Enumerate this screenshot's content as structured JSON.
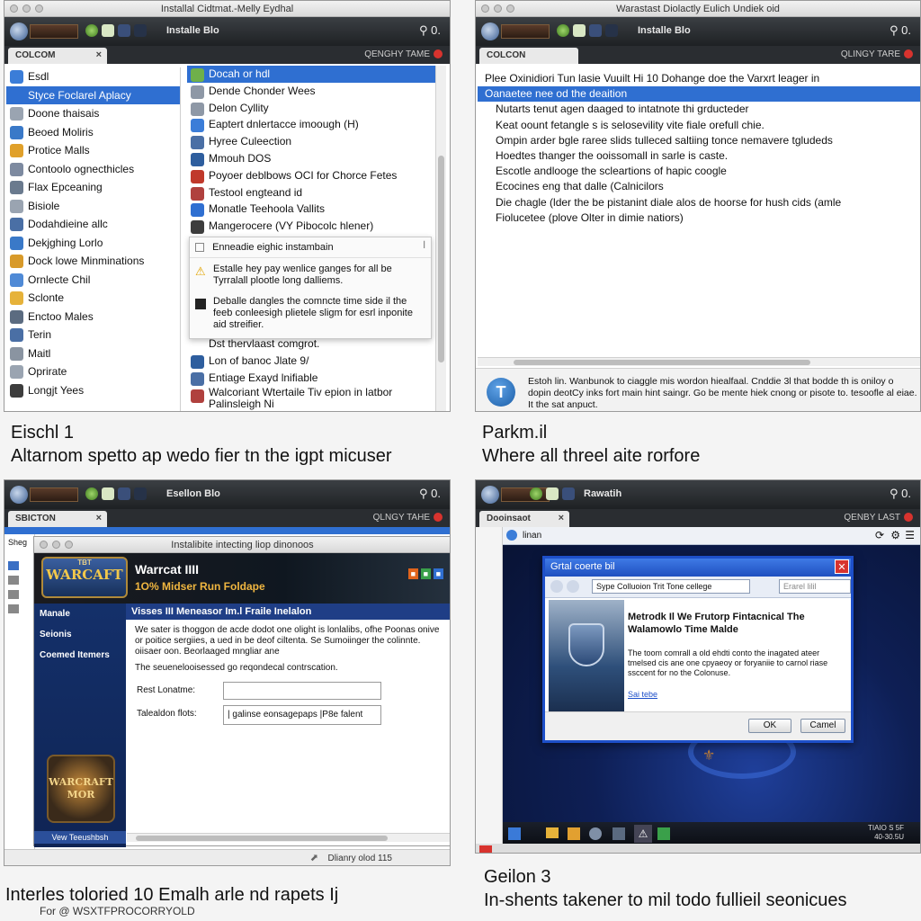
{
  "colors": {
    "selection": "#2f6fd1",
    "toolbar": "#1e2124",
    "accent_red": "#d8332e",
    "wow_blue": "#1e3a8a"
  },
  "panel1": {
    "window_title": "Installal Cidtmat.-Melly Eydhal",
    "toolbar_title": "Installe Blo",
    "toolbar_right": "⚲ 0.",
    "tab_label": "COLCOM",
    "tab_close": "×",
    "tabrow_right": "QENGHY TAME",
    "sidebar_items": [
      {
        "label": "Esdl",
        "icon": "globe-icon",
        "color": "#3b7dd8"
      },
      {
        "label": "Styce Foclarel Aplacy",
        "icon": "app-icon",
        "color": "#2f6fd1",
        "selected": true
      },
      {
        "label": "Doone thaisais",
        "icon": "document-icon",
        "color": "#9aa4b1"
      },
      {
        "label": "Beoed Moliris",
        "icon": "disk-icon",
        "color": "#3a79c8"
      },
      {
        "label": "Protice Malls",
        "icon": "folder-icon",
        "color": "#e0a02a"
      },
      {
        "label": "Contoolo ognecthicles",
        "icon": "gear-icon",
        "color": "#7d8aa0"
      },
      {
        "label": "Flax Epceaning",
        "icon": "list-icon",
        "color": "#6a7a8e"
      },
      {
        "label": "Bisiole",
        "icon": "file-icon",
        "color": "#9aa4b1"
      },
      {
        "label": "Dodahdieine allc",
        "icon": "image-icon",
        "color": "#4a6fa5"
      },
      {
        "label": "Dekjghing Lorlo",
        "icon": "monitor-icon",
        "color": "#3a79c8"
      },
      {
        "label": "Dock lowe Minminations",
        "icon": "folder-icon",
        "color": "#d89a2a"
      },
      {
        "label": "Ornlecte Chil",
        "icon": "disk-icon",
        "color": "#4f8ad6"
      },
      {
        "label": "Sclonte",
        "icon": "folder-icon",
        "color": "#e6b23a"
      },
      {
        "label": "Enctoo Males",
        "icon": "mail-icon",
        "color": "#5b6b80"
      },
      {
        "label": "Terin",
        "icon": "network-icon",
        "color": "#4a6fa5"
      },
      {
        "label": "Maitl",
        "icon": "document-icon",
        "color": "#8a94a1"
      },
      {
        "label": "Oprirate",
        "icon": "lightbulb-icon",
        "color": "#9aa4b1"
      },
      {
        "label": "Longjt Yees",
        "icon": "terminal-icon",
        "color": "#3d3d3d"
      }
    ],
    "content_items": [
      {
        "label": "Docah or hdl",
        "icon": "app-icon",
        "color": "#6fb04a",
        "selected": true
      },
      {
        "label": "Dende Chonder Wees",
        "icon": "document-icon",
        "color": "#8e98a6"
      },
      {
        "label": "Delon Cyllity",
        "icon": "document-icon",
        "color": "#8e98a6"
      },
      {
        "label": "Eaptert dnlertacce imoough (H)",
        "icon": "globe-icon",
        "color": "#3b7dd8"
      },
      {
        "label": "Hyree Culeection",
        "icon": "monitor-icon",
        "color": "#4a6fa5"
      },
      {
        "label": "Mmouh DOS",
        "icon": "disk-icon",
        "color": "#2e5e9e"
      },
      {
        "label": "Poyoer deblbows OCI for Chorce Fetes",
        "icon": "box-icon",
        "color": "#c0392b"
      },
      {
        "label": "Testool engteand id",
        "icon": "book-icon",
        "color": "#b0413e"
      },
      {
        "label": "Monatle Teehoola Vallits",
        "icon": "globe-icon",
        "color": "#2f6fd1"
      },
      {
        "label": "Mangerocere (VY Pibocolc hlener)",
        "icon": "monitor-icon",
        "color": "#3d3d3d"
      }
    ],
    "content_items_after": [
      {
        "label": "Dst thervlaast comgrot.",
        "icon": "none",
        "color": "#ffffff"
      },
      {
        "label": "Lon of banoc Jlate 9/",
        "icon": "globe-icon",
        "color": "#2e5e9e"
      },
      {
        "label": "Entiage Exayd lnifiable",
        "icon": "gear-icon",
        "color": "#4a6fa5"
      },
      {
        "label": "Walcoriant Wtertaile Tiv epion in latbor Palinsleigh Ni",
        "icon": "globe-icon",
        "color": "#b0413e"
      }
    ],
    "tooltip": {
      "header": "Enneadie eighic instambain",
      "warning": "Estalle hey pay wenlice ganges for all be Tyrralall plootle long dalliems.",
      "info": "Deballe dangles the comncte time side il the feeb conleesigh plietele sligm for esrl inponite aid streifier."
    },
    "caption_title": "Eischl 1",
    "caption_sub": "Altarnom spetto ap wedo fier tn the igpt micuser"
  },
  "panel2": {
    "window_title": "Warastast Diolactly Eulich Undiek oid",
    "toolbar_title": "Installe Blo",
    "toolbar_right": "⚲ 0.",
    "tab_label": "COLCON",
    "tabrow_right": "QLINGY TARE",
    "lines": [
      "Plee Oxinidiori Tun lasie Vuuilt Hi 10 Dohange doe the Varxrt leager in",
      "Oanaetee nee od the deaition",
      "Nutarts tenut agen daaged to intatnote thi grducteder",
      "Keat oount fetangle s is selosevility vite fiale orefull chie.",
      "Ompin arder bgle raree slids tulleced saltiing tonce nemavere tgludeds",
      "Hoedtes thanger the ooissomall in sarle is caste.",
      "Escotle andlooge the scleartions of hapic coogle",
      "Ecocines eng that dalle (Calnicilors",
      "Die chagle (lder the be pistanint diale alos de hoorse for hush cids (amle",
      "Fiolucetee (plove Olter in dimie natiors)"
    ],
    "footer_text": "Estoh lin. Wanbunok to ciaggle mis wordon hiealfaal. Cnddie 3l that bodde th is oniloy o dopin deotCy inks fort main hint saingr. Go be mente hiek cnong or pisote to. tesoofle al eiae. It the sat anpuct.",
    "footer_icon": "T",
    "caption_title": "Parkm.il",
    "caption_sub": "Where all threel aite rorfore"
  },
  "panel3": {
    "toolbar_title": "Esellon Blo",
    "toolbar_right": "⚲ 0.",
    "tab_label": "SBICTON",
    "tabrow_right": "QLNGY TAHE",
    "inner_title": "Instalibite intecting liop dinonoos",
    "logo_text": "WARCAFT",
    "logo_top": "TBT",
    "app_name": "Warrcat IIII",
    "app_sub": "1O% Midser Run Foldape",
    "header_badges": "⬛ ⬛ ⬛",
    "nav": [
      "Manale",
      "Seionis",
      "Coemed Itemers"
    ],
    "section_header": "Visses III Meneasor Im.l Fraile Inelalon",
    "desc": "We sater is thoggon de acde dodot one olight is lonlalibs, ofhe Poonas onive or poitice sergiies, a ued in be deof ciltenta. Se Sumoiinger the colinnte. oiisaer oon. Beorlaaged mngliar ane",
    "desc2": "The seuenelooisessed go reqondecal contrscation.",
    "field1_label": "Rest Lonatme:",
    "field1_value": "",
    "field2_label": "Talealdon flots:",
    "field2_value": "| galinse eonsagepaps |P8e falent",
    "box_logo": "WARCRAFT MOR",
    "box_footer": "Vew Teeushbsh",
    "status_right": "Dlianry olod 115",
    "side_header": "Sheg",
    "caption_sub": "Interles toloried 10 Emalh arle nd rapets Ij",
    "caption_credit": "For @ WSXTFPROCORRYOLD"
  },
  "panel4": {
    "toolbar_title": "Rawatih",
    "toolbar_right": "⚲ 0.",
    "tab_label": "Dooinsaot",
    "tab_close": "×",
    "tabrow_right": "QENBY LAST",
    "addr": "linan",
    "dialog": {
      "title": "Grtal coerte bil",
      "combo": "Sype Colluoion Trit Tone cellege",
      "combo2": "Erarel lilil",
      "heading": "Metrodk Il We Frutorp Fintacnical The Walamowlo Time Malde",
      "body": "The toom comrall a old ehdti conto the inagated ateer tmelsed cis ane one cpyaeoy or foryaniie to carnol riase ssccent for no the Colonuse.",
      "link": "Sai tebe",
      "ok": "OK",
      "cancel": "Camel"
    },
    "taskbar_right": "TIAIO S 5F\n40-30.5U",
    "caption_title": "Geilon 3",
    "caption_sub": "In-shents takener to mil todo fullieil seonicues"
  }
}
